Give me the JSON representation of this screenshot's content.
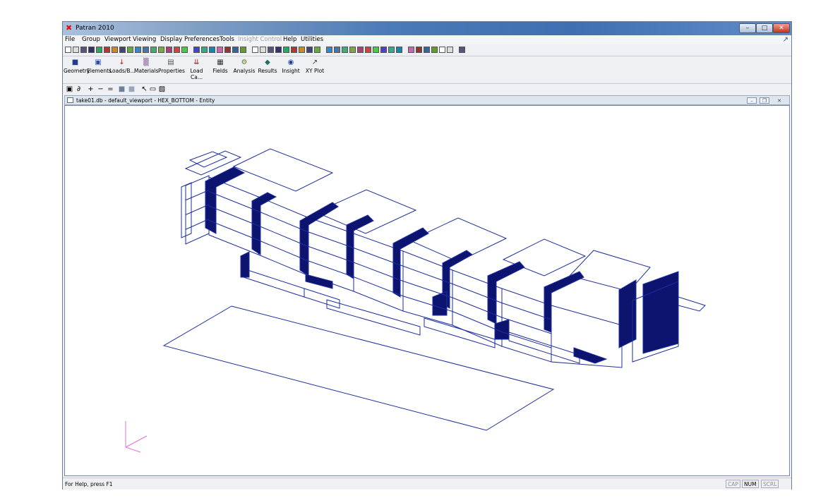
{
  "window": {
    "title": "Patran 2010",
    "logo_glyph": "✖",
    "controls": {
      "minimize": "–",
      "maximize": "□",
      "close": "✕"
    }
  },
  "menubar": {
    "items": [
      {
        "label": "File",
        "enabled": true
      },
      {
        "label": "Group",
        "enabled": true
      },
      {
        "label": "Viewport",
        "enabled": true
      },
      {
        "label": "Viewing",
        "enabled": true
      },
      {
        "label": "Display",
        "enabled": true
      },
      {
        "label": "Preferences",
        "enabled": true
      },
      {
        "label": "Tools",
        "enabled": true
      },
      {
        "label": "Insight Control",
        "enabled": false
      },
      {
        "label": "Help",
        "enabled": true
      },
      {
        "label": "Utilities",
        "enabled": true
      }
    ],
    "corner_icon": "↗"
  },
  "app_toolbar": {
    "buttons": [
      {
        "label": "Geometry",
        "icon": "cube-icon",
        "glyph": "■",
        "color": "#1f3f8f"
      },
      {
        "label": "Elements",
        "icon": "mesh-icon",
        "glyph": "▣",
        "color": "#2a4fa8"
      },
      {
        "label": "Loads/B...",
        "icon": "load-arrow-icon",
        "glyph": "↓",
        "color": "#b02020"
      },
      {
        "label": "Materials",
        "icon": "material-icon",
        "glyph": "▒",
        "color": "#7a4a90"
      },
      {
        "label": "Properties",
        "icon": "properties-icon",
        "glyph": "▤",
        "color": "#555555"
      },
      {
        "label": "Load Ca...",
        "icon": "load-case-icon",
        "glyph": "⇊",
        "color": "#b02020"
      },
      {
        "label": "Fields",
        "icon": "fields-icon",
        "glyph": "▦",
        "color": "#333333"
      },
      {
        "label": "Analysis",
        "icon": "analysis-icon",
        "glyph": "⚙",
        "color": "#5a7f20"
      },
      {
        "label": "Results",
        "icon": "results-icon",
        "glyph": "◆",
        "color": "#1f6f5f"
      },
      {
        "label": "Insight",
        "icon": "insight-icon",
        "glyph": "◉",
        "color": "#1f3f8f"
      },
      {
        "label": "XY Plot",
        "icon": "xy-plot-icon",
        "glyph": "↗",
        "color": "#3a3a3a"
      }
    ]
  },
  "view_toolbar": {
    "items": [
      {
        "glyph": "▣",
        "icon": "select-icon"
      },
      {
        "glyph": "∂",
        "icon": "rotate-icon"
      },
      {
        "glyph": "+",
        "icon": "zoom-in-icon"
      },
      {
        "glyph": "−",
        "icon": "zoom-out-icon"
      },
      {
        "glyph": "=",
        "icon": "fit-view-icon"
      },
      {
        "glyph": "■",
        "icon": "shade-icon"
      },
      {
        "glyph": "■",
        "icon": "wireframe-icon"
      },
      {
        "glyph": "↖",
        "icon": "pick-arrow-icon"
      },
      {
        "glyph": "▭",
        "icon": "rectangle-pick-icon"
      },
      {
        "glyph": "▨",
        "icon": "polygon-pick-icon"
      }
    ]
  },
  "viewport": {
    "title": "take01.db - default_viewport - HEX_BOTTOM - Entity",
    "controls": {
      "minimize": "–",
      "restore": "❐",
      "close": "✕"
    },
    "model_line_color": "#1c2e9c",
    "model_fill_color": "#0c1470",
    "triad_color": "#e070d8"
  },
  "statusbar": {
    "text": "For Help, press F1",
    "indicators": [
      {
        "label": "CAP",
        "active": false
      },
      {
        "label": "NUM",
        "active": true
      },
      {
        "label": "SCRL",
        "active": false
      }
    ]
  }
}
